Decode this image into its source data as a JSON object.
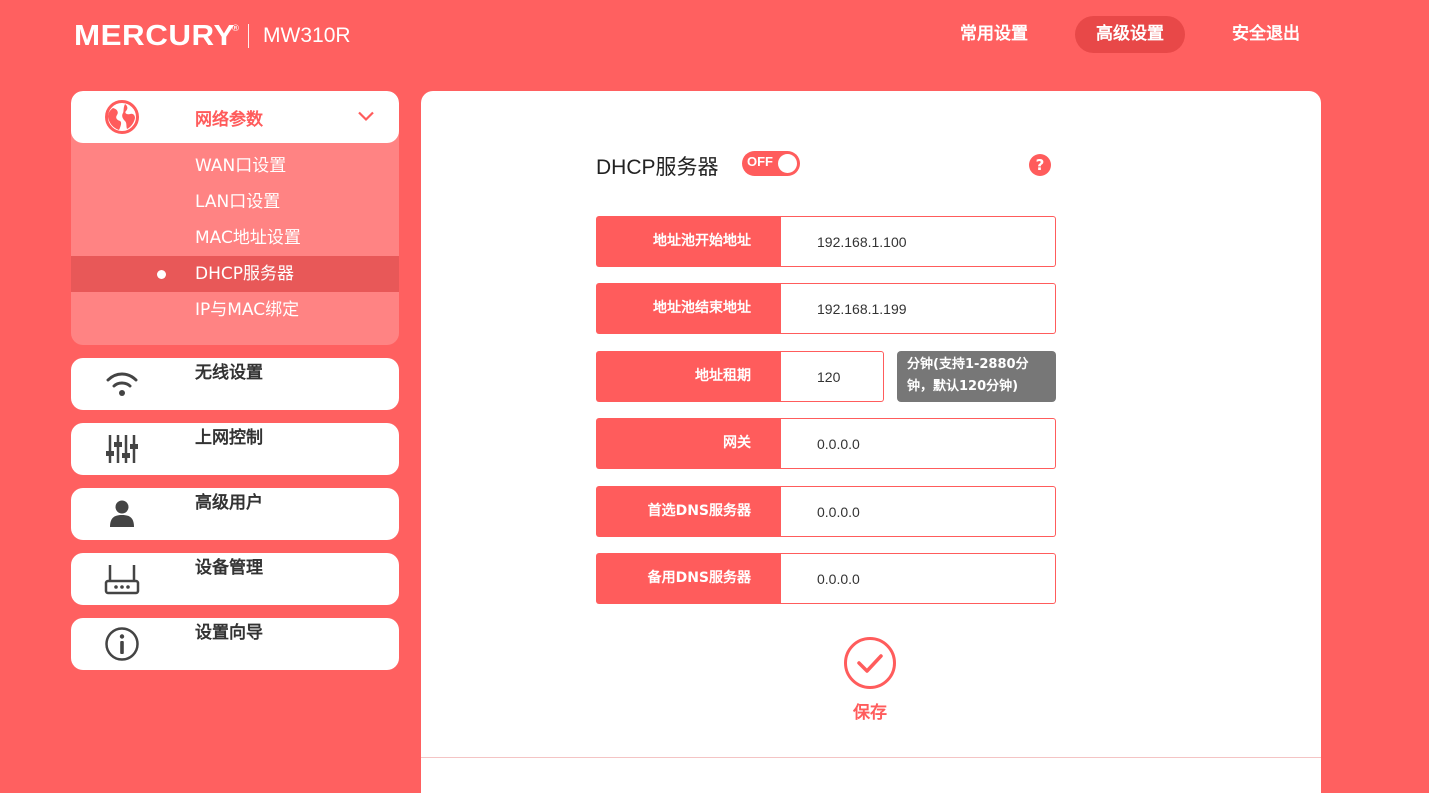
{
  "header": {
    "brand": "MERCURY",
    "brand_mark": "®",
    "model": "MW310R",
    "nav": [
      {
        "label": "常用设置",
        "active": false
      },
      {
        "label": "高级设置",
        "active": true
      },
      {
        "label": "安全退出",
        "active": false
      }
    ]
  },
  "sidebar": {
    "network": {
      "label": "网络参数",
      "icon": "globe-icon",
      "items": [
        "WAN口设置",
        "LAN口设置",
        "MAC地址设置",
        "DHCP服务器",
        "IP与MAC绑定"
      ],
      "active_item": "DHCP服务器"
    },
    "menus": [
      {
        "label": "无线设置",
        "icon": "wifi-icon"
      },
      {
        "label": "上网控制",
        "icon": "sliders-icon"
      },
      {
        "label": "高级用户",
        "icon": "user-icon"
      },
      {
        "label": "设备管理",
        "icon": "router-icon"
      },
      {
        "label": "设置向导",
        "icon": "info-icon"
      }
    ]
  },
  "main": {
    "title": "DHCP服务器",
    "toggle": {
      "label": "OFF",
      "state": "off"
    },
    "help": "?",
    "fields": [
      {
        "label": "地址池开始地址",
        "value": "192.168.1.100"
      },
      {
        "label": "地址池结束地址",
        "value": "192.168.1.199"
      },
      {
        "label": "地址租期",
        "value": "120",
        "tip": "分钟(支持1-2880分钟，默认120分钟)"
      },
      {
        "label": "网关",
        "value": "0.0.0.0"
      },
      {
        "label": "首选DNS服务器",
        "value": "0.0.0.0"
      },
      {
        "label": "备用DNS服务器",
        "value": "0.0.0.0"
      }
    ],
    "save_label": "保存"
  },
  "colors": {
    "brand": "#ff6060",
    "accent": "#ff5c5c",
    "active_nav": "#e84848",
    "tip_bg": "#777777"
  }
}
